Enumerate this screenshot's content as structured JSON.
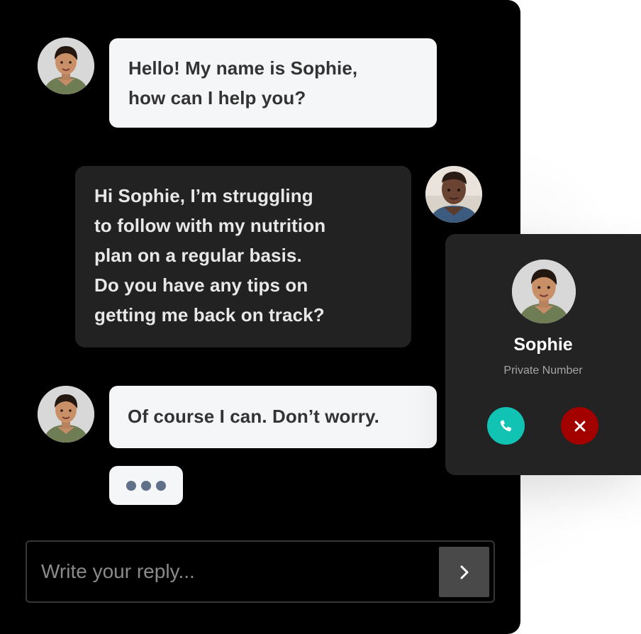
{
  "messages": [
    {
      "sender": "Sophie",
      "lines": [
        "Hello! My name is Sophie,",
        "how can I help you?"
      ]
    },
    {
      "sender": "user",
      "lines": [
        "Hi Sophie, I’m struggling",
        "to follow with my nutrition",
        "plan on a regular basis.",
        "Do you have any tips on",
        "getting me back on track?"
      ]
    },
    {
      "sender": "Sophie",
      "lines": [
        "Of course I can. Don’t worry."
      ]
    }
  ],
  "typing_indicator": {
    "dots": 3
  },
  "reply": {
    "placeholder": "Write your reply...",
    "value": ""
  },
  "call": {
    "name": "Sophie",
    "subtitle": "Private Number"
  },
  "colors": {
    "background": "#000000",
    "light_bubble": "#f5f6f8",
    "dark_bubble": "#222222",
    "accept": "#11c3b3",
    "decline": "#a30000",
    "send_button": "#494949",
    "typing_dot": "#5f7088"
  },
  "icons": {
    "send": "chevron-right-icon",
    "accept": "phone-icon",
    "decline": "close-icon"
  }
}
